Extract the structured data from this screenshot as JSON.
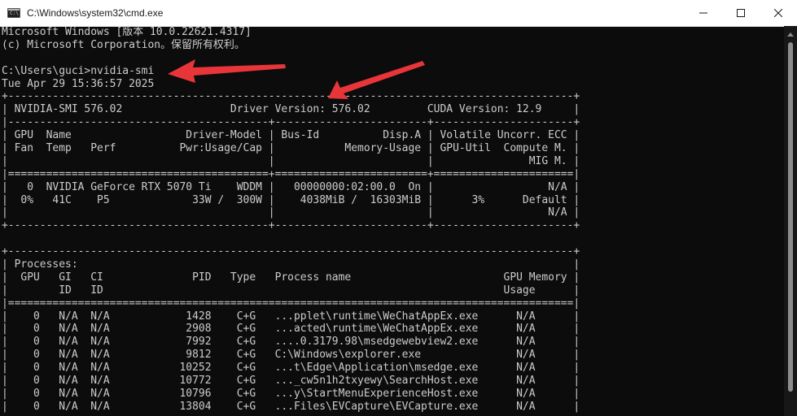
{
  "window": {
    "title": "C:\\Windows\\system32\\cmd.exe",
    "app_icon_text": "C:\\"
  },
  "controls": {
    "minimize": "minimize-icon",
    "maximize": "maximize-icon",
    "close": "close-icon"
  },
  "terminal": {
    "lines": [
      "Microsoft Windows [版本 10.0.22621.4317]",
      "(c) Microsoft Corporation。保留所有权利。",
      "",
      "C:\\Users\\guci>nvidia-smi",
      "Tue Apr 29 15:36:57 2025",
      "+-----------------------------------------------------------------------------------------+",
      "| NVIDIA-SMI 576.02                 Driver Version: 576.02         CUDA Version: 12.9     |",
      "|-----------------------------------------+------------------------+----------------------+",
      "| GPU  Name                  Driver-Model | Bus-Id          Disp.A | Volatile Uncorr. ECC |",
      "| Fan  Temp   Perf          Pwr:Usage/Cap |           Memory-Usage | GPU-Util  Compute M. |",
      "|                                         |                        |               MIG M. |",
      "|=========================================+========================+======================|",
      "|   0  NVIDIA GeForce RTX 5070 Ti    WDDM |   00000000:02:00.0  On |                  N/A |",
      "|  0%   41C    P5             33W /  300W |    4038MiB /  16303MiB |      3%      Default |",
      "|                                         |                        |                  N/A |",
      "+-----------------------------------------+------------------------+----------------------+",
      "",
      "+-----------------------------------------------------------------------------------------+",
      "| Processes:                                                                              |",
      "|  GPU   GI   CI              PID   Type   Process name                        GPU Memory |",
      "|        ID   ID                                                               Usage      |",
      "|=========================================================================================|",
      "|    0   N/A  N/A            1428    C+G   ...pplet\\runtime\\WeChatAppEx.exe      N/A      |",
      "|    0   N/A  N/A            2908    C+G   ...acted\\runtime\\WeChatAppEx.exe      N/A      |",
      "|    0   N/A  N/A            7992    C+G   ....0.3179.98\\msedgewebview2.exe      N/A      |",
      "|    0   N/A  N/A            9812    C+G   C:\\Windows\\explorer.exe               N/A      |",
      "|    0   N/A  N/A           10252    C+G   ...t\\Edge\\Application\\msedge.exe      N/A      |",
      "|    0   N/A  N/A           10772    C+G   ..._cw5n1h2txyewy\\SearchHost.exe      N/A      |",
      "|    0   N/A  N/A           10796    C+G   ...y\\StartMenuExperienceHost.exe      N/A      |",
      "|    0   N/A  N/A           13804    C+G   ...Files\\EVCapture\\EVCapture.exe      N/A      |"
    ]
  },
  "annotations": {
    "arrow_color": "#e8353a"
  }
}
